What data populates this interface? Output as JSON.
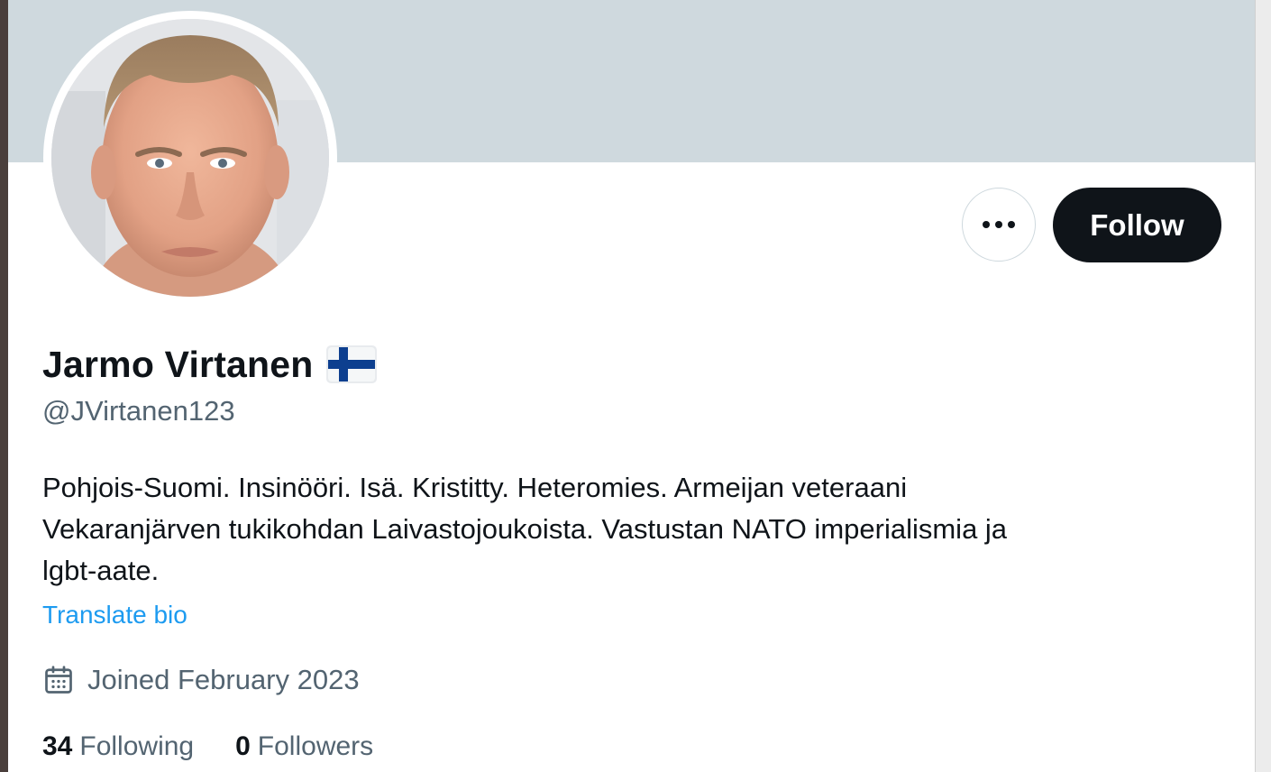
{
  "profile": {
    "display_name": "Jarmo Virtanen",
    "flag_icon": "finland-flag-icon",
    "handle": "@JVirtanen123",
    "bio_lines": [
      "Pohjois-Suomi. Insinööri. Isä. Kristitty. Heteromies. Armeijan veteraani",
      "Vekaranjärven tukikohdan Laivastojoukoista. Vastustan NATO imperialismia ja",
      "lgbt-aate."
    ],
    "translate_label": "Translate bio",
    "joined_icon": "calendar-icon",
    "joined": "Joined February 2023",
    "following_count": "34",
    "following_label": "Following",
    "followers_count": "0",
    "followers_label": "Followers"
  },
  "actions": {
    "more_icon": "more-horizontal-icon",
    "follow_label": "Follow"
  },
  "colors": {
    "banner": "#cfd9de",
    "primary_text": "#0f1419",
    "secondary_text": "#536471",
    "link": "#1d9bf0",
    "follow_bg": "#0f1419"
  }
}
